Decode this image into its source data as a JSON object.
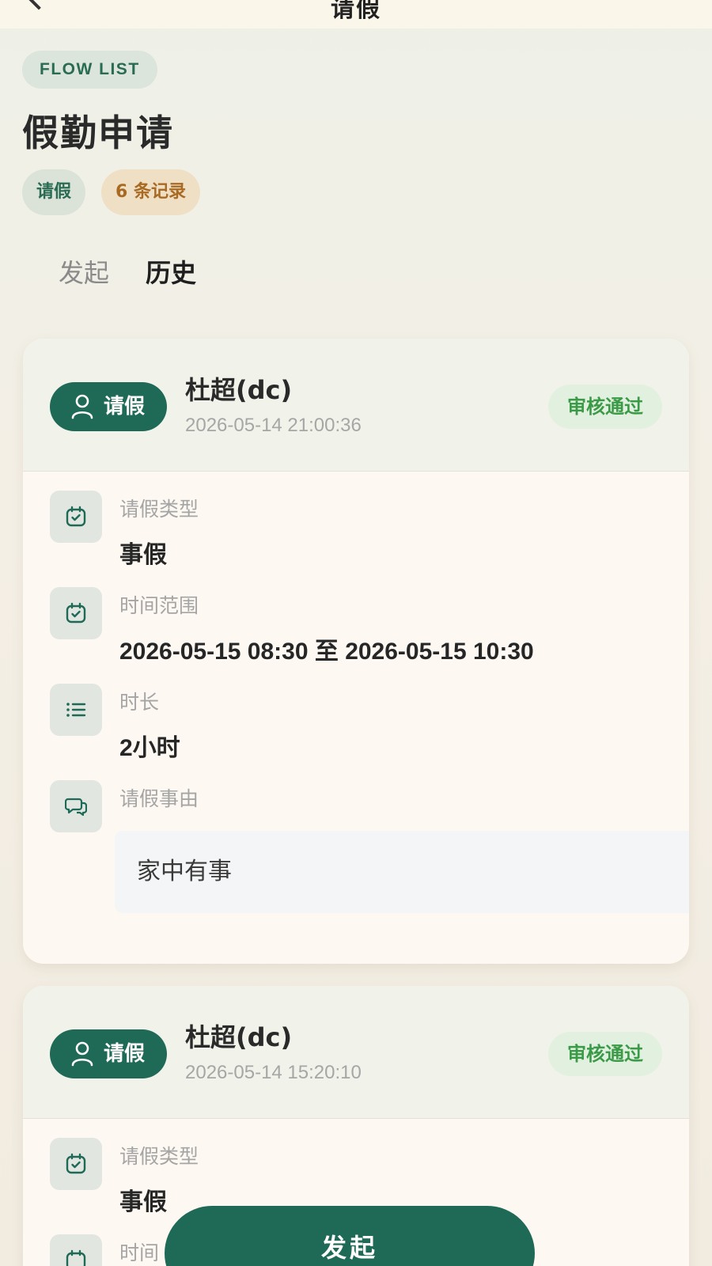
{
  "nav": {
    "title": "请假"
  },
  "header": {
    "badge": "FLOW LIST",
    "title": "假勤申请",
    "chip_type": "请假",
    "chip_count": "6 条记录"
  },
  "tabs": [
    {
      "label": "发起",
      "active": false
    },
    {
      "label": "历史",
      "active": true
    }
  ],
  "records": [
    {
      "type_label": "请假",
      "applicant": "杜超(dc)",
      "submitted_at": "2026-05-14 21:00:36",
      "status": "审核通过",
      "fields": {
        "leave_type_label": "请假类型",
        "leave_type_value": "事假",
        "range_label": "时间范围",
        "range_value": "2026-05-15 08:30 至 2026-05-15 10:30",
        "duration_label": "时长",
        "duration_value": "2小时",
        "reason_label": "请假事由",
        "reason_value": "家中有事"
      }
    },
    {
      "type_label": "请假",
      "applicant": "杜超(dc)",
      "submitted_at": "2026-05-14 15:20:10",
      "status": "审核通过",
      "fields": {
        "leave_type_label": "请假类型",
        "leave_type_value": "事假",
        "range_label": "时间"
      }
    }
  ],
  "fab": {
    "label": "发起"
  },
  "colors": {
    "primary": "#1f6a57",
    "status_bg": "#e2f1df",
    "status_text": "#3b9a47",
    "count_chip_bg": "#efdfc4",
    "count_chip_text": "#a86a22"
  }
}
